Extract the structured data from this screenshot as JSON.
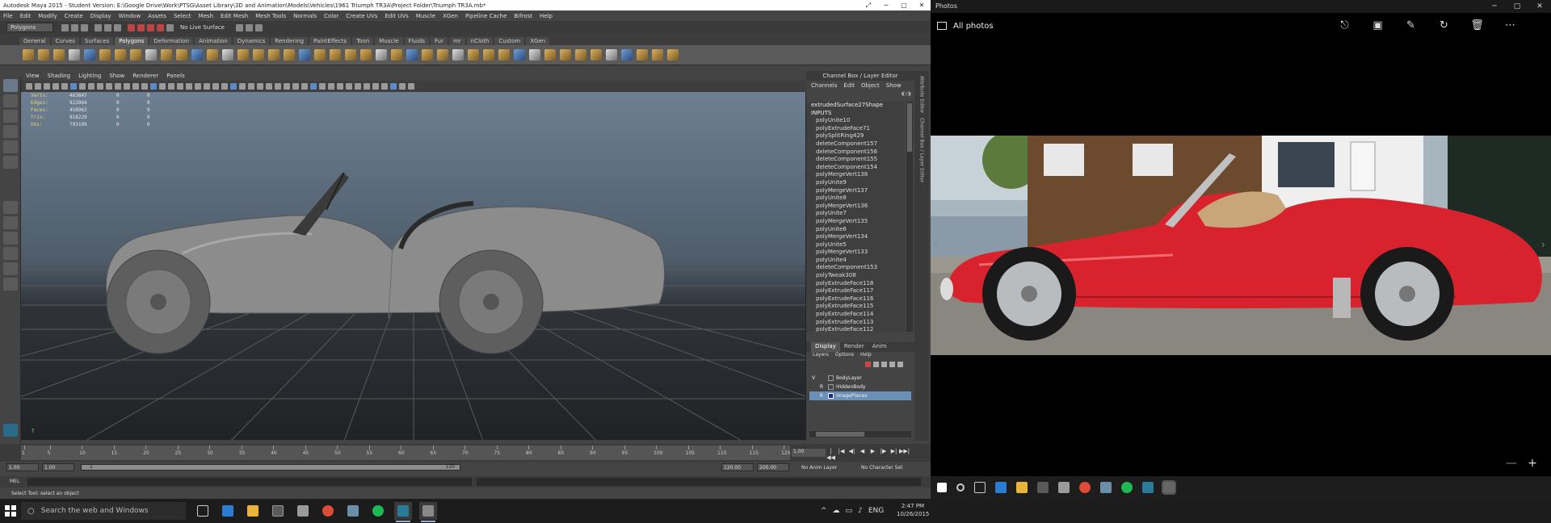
{
  "maya": {
    "title": "Autodesk Maya 2015 - Student Version: E:\\Google Drive\\Work\\PTSG\\Asset Library\\3D and Animation\\Models\\Vehicles\\1961 Triumph TR3A\\Project Folder\\Triumph TR3A.mb*",
    "menu": [
      "File",
      "Edit",
      "Modify",
      "Create",
      "Display",
      "Window",
      "Assets",
      "Select",
      "Mesh",
      "Edit Mesh",
      "Mesh Tools",
      "Normals",
      "Color",
      "Create UVs",
      "Edit UVs",
      "Muscle",
      "XGen",
      "Pipeline Cache",
      "Bifrost",
      "Help"
    ],
    "menu_mode": "Polygons",
    "no_live_surface": "No Live Surface",
    "shelf_tabs": [
      "General",
      "Curves",
      "Surfaces",
      "Polygons",
      "Deformation",
      "Animation",
      "Dynamics",
      "Rendering",
      "PaintEffects",
      "Toon",
      "Muscle",
      "Fluids",
      "Fur",
      "mr",
      "nCloth",
      "Custom",
      "XGen"
    ],
    "active_shelf_tab": "Polygons",
    "viewport_menu": [
      "View",
      "Shading",
      "Lighting",
      "Show",
      "Renderer",
      "Panels"
    ],
    "hud": [
      {
        "label": "Verts:",
        "value": "463847",
        "a": "0",
        "b": "0"
      },
      {
        "label": "Edges:",
        "value": "922864",
        "a": "0",
        "b": "0"
      },
      {
        "label": "Faces:",
        "value": "458963",
        "a": "0",
        "b": "0"
      },
      {
        "label": "Tris:",
        "value": "918229",
        "a": "0",
        "b": "0"
      },
      {
        "label": "UVs:",
        "value": "793109",
        "a": "0",
        "b": "0"
      }
    ],
    "channel_box": {
      "title": "Channel Box / Layer Editor",
      "menu": [
        "Channels",
        "Edit",
        "Object",
        "Show"
      ],
      "shape": "extrudedSurface27Shape",
      "inputs_label": "INPUTS",
      "nodes": [
        "polyUnite10",
        "polyExtrudeFace71",
        "polySplitRing429",
        "deleteComponent157",
        "deleteComponent156",
        "deleteComponent155",
        "deleteComponent154",
        "polyMergeVert138",
        "polyUnite9",
        "polyMergeVert137",
        "polyUnite8",
        "polyMergeVert136",
        "polyUnite7",
        "polyMergeVert135",
        "polyUnite6",
        "polyMergeVert134",
        "polyUnite5",
        "polyMergeVert133",
        "polyUnite4",
        "deleteComponent153",
        "polyTweak308",
        "polyExtrudeFace118",
        "polyExtrudeFace117",
        "polyExtrudeFace116",
        "polyExtrudeFace115",
        "polyExtrudeFace114",
        "polyExtrudeFace113",
        "polyExtrudeFace112"
      ],
      "side_tabs": [
        "Attribute Editor",
        "Channel Box / Layer Editor"
      ]
    },
    "layer_editor": {
      "tabs": [
        "Display",
        "Render",
        "Anim"
      ],
      "active_tab": "Display",
      "menu": [
        "Layers",
        "Options",
        "Help"
      ],
      "layers": [
        {
          "vis": "V",
          "playback": "",
          "name": "BodyLayer",
          "selected": false
        },
        {
          "vis": "",
          "playback": "R",
          "name": "HiddenBody",
          "selected": false
        },
        {
          "vis": "",
          "playback": "R",
          "name": "ImagePlanes",
          "selected": true
        }
      ]
    },
    "time_slider": {
      "ticks": [
        "1",
        "5",
        "10",
        "15",
        "20",
        "25",
        "30",
        "35",
        "40",
        "45",
        "50",
        "55",
        "60",
        "65",
        "70",
        "75",
        "80",
        "85",
        "90",
        "95",
        "100",
        "105",
        "110",
        "115",
        "120"
      ],
      "current": "1.00",
      "play_buttons": [
        "|◀◀",
        "|◀",
        "◀|",
        "◀",
        "▶",
        "|▶",
        "▶|",
        "▶▶|"
      ]
    },
    "range": {
      "start": "1.00",
      "start_inner": "1.00",
      "bar_left": "1",
      "bar_right": "120",
      "end_inner": "120.00",
      "end": "200.00",
      "anim_layer": "No Anim Layer",
      "char_set": "No Character Set"
    },
    "command_line_label": "MEL",
    "help_line": "Select Tool: select an object"
  },
  "photos": {
    "title": "Photos",
    "location": "All photos",
    "actions": [
      "share-icon",
      "slideshow-icon",
      "edit-icon",
      "rotate-icon",
      "delete-icon",
      "more-icon"
    ],
    "nav_prev": "‹",
    "nav_next": "›",
    "zoom_out": "—",
    "zoom_in": "+"
  },
  "taskbar": {
    "search_placeholder": "Search the web and Windows",
    "time": "2:47 PM",
    "date": "10/26/2015",
    "tray": [
      "^",
      "☁",
      "▭",
      "♪",
      "ENG"
    ]
  },
  "colors": {
    "car_red": "#d8222d",
    "interior_tan": "#c9a679",
    "maya_bg": "#444444",
    "layer_selected": "#6a90b8"
  }
}
